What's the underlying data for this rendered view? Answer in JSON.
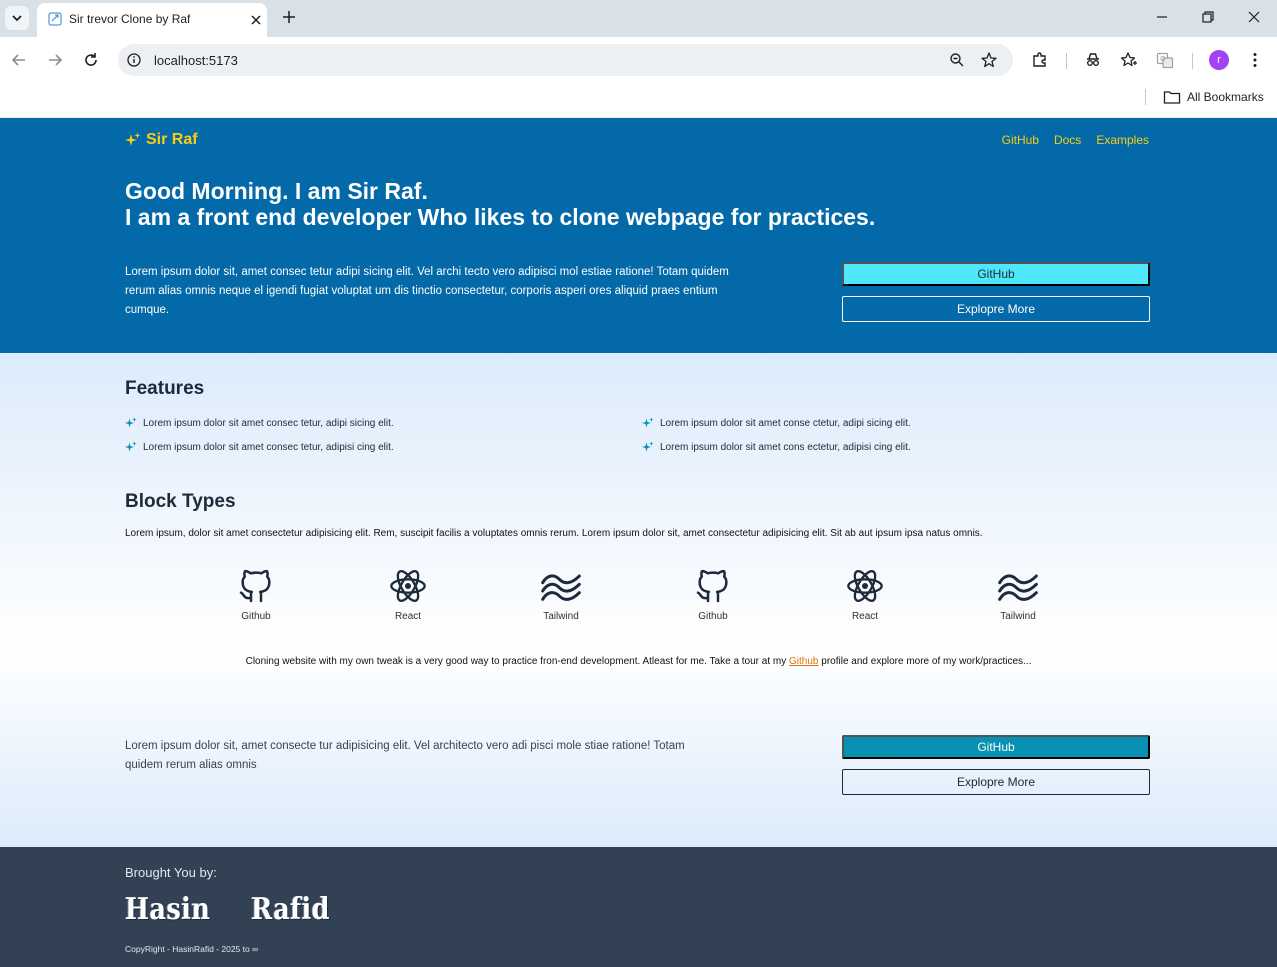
{
  "browser": {
    "tab_title": "Sir trevor Clone by Raf",
    "url": "localhost:5173",
    "bookmarks_label": "All Bookmarks",
    "profile_initial": "r"
  },
  "header": {
    "logo": "Sir Raf",
    "nav": [
      "GitHub",
      "Docs",
      "Examples"
    ]
  },
  "hero": {
    "title_line1": "Good Morning. I am Sir Raf.",
    "title_line2": "I am a front end developer Who likes to clone webpage for practices.",
    "description": "Lorem ipsum dolor sit, amet consec tetur adipi sicing elit. Vel archi tecto vero adipisci mol estiae ratione! Totam quidem rerum alias omnis neque el igendi fugiat voluptat um dis tinctio consectetur, corporis asperi ores aliquid praes entium cumque.",
    "primary_button": "GitHub",
    "secondary_button": "Explopre More"
  },
  "features": {
    "title": "Features",
    "items": [
      "Lorem ipsum dolor sit amet consec tetur, adipi sicing elit.",
      "Lorem ipsum dolor sit amet conse ctetur, adipi sicing elit.",
      "Lorem ipsum dolor sit amet consec tetur, adipisi cing elit.",
      "Lorem ipsum dolor sit amet cons ectetur, adipisi cing elit."
    ]
  },
  "block_types": {
    "title": "Block Types",
    "description": "Lorem ipsum, dolor sit amet consectetur adipisicing elit. Rem, suscipit facilis a voluptates omnis rerum. Lorem ipsum dolor sit, amet consectetur adipisicing elit. Sit ab aut ipsum ipsa natus omnis.",
    "items": [
      {
        "label": "Github",
        "icon": "github-icon"
      },
      {
        "label": "React",
        "icon": "react-icon"
      },
      {
        "label": "Tailwind",
        "icon": "tailwind-icon"
      },
      {
        "label": "Github",
        "icon": "github-icon"
      },
      {
        "label": "React",
        "icon": "react-icon"
      },
      {
        "label": "Tailwind",
        "icon": "tailwind-icon"
      }
    ],
    "cloning_before": "Cloning website with my own tweak is a very good way to practice fron-end development. Atleast for me. Take a tour at my ",
    "cloning_link": "Github",
    "cloning_after": " profile and explore more of my work/practices..."
  },
  "cta": {
    "description": "Lorem ipsum dolor sit, amet consecte tur adipisicing elit. Vel architecto vero adi pisci mole stiae ratione! Totam quidem rerum alias omnis",
    "primary_button": "GitHub",
    "secondary_button": "Explopre More"
  },
  "footer": {
    "brought_by": "Brought You by:",
    "first_name": "Hasin",
    "last_name": "Rafid",
    "copyright": "CopyRight - HasinRafid - 2025 to ∞"
  },
  "colors": {
    "hero_bg": "#0369a9",
    "accent_yellow": "#facc15",
    "cyan_button": "#4ee7fd",
    "teal_button": "#0891b2",
    "footer_bg": "#334155"
  }
}
